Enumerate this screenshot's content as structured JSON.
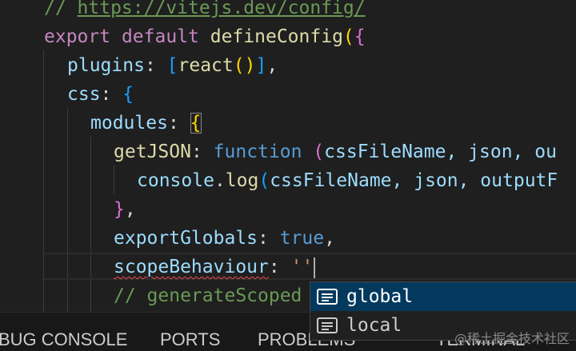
{
  "code": {
    "comment_prefix": "// ",
    "comment_url": "https://vitejs.dev/config/",
    "kw_export": "export",
    "kw_default": "default",
    "fn_define": "defineConfig",
    "paren_open": "(",
    "brace_open": "{",
    "prop_plugins": "plugins",
    "colon": ":",
    "bracket_open": "[",
    "fn_react": "react",
    "call_parens": "()",
    "bracket_close": "]",
    "comma": ",",
    "prop_css": "css",
    "prop_modules": "modules",
    "prop_getJSON": "getJSON",
    "kw_function": "function",
    "params": "cssFileName, json, ou",
    "console_obj": "console",
    "dot": ".",
    "fn_log": "log",
    "log_args": "cssFileName, json, outputF",
    "brace_close": "}",
    "prop_exportGlobals": "exportGlobals",
    "kw_true": "true",
    "prop_scopeBehaviour": "scopeBehaviour",
    "typed_string": "''",
    "comment_generate": "// generateScoped"
  },
  "suggestions": {
    "items": [
      {
        "label": "global",
        "icon": "text-icon",
        "active": true
      },
      {
        "label": "local",
        "icon": "text-icon",
        "active": false
      }
    ]
  },
  "panel": {
    "tabs": [
      "BUG CONSOLE",
      "PORTS",
      "PROBLEMS",
      "TERMINAL"
    ]
  },
  "watermark": "@稀土掘金技术社区"
}
